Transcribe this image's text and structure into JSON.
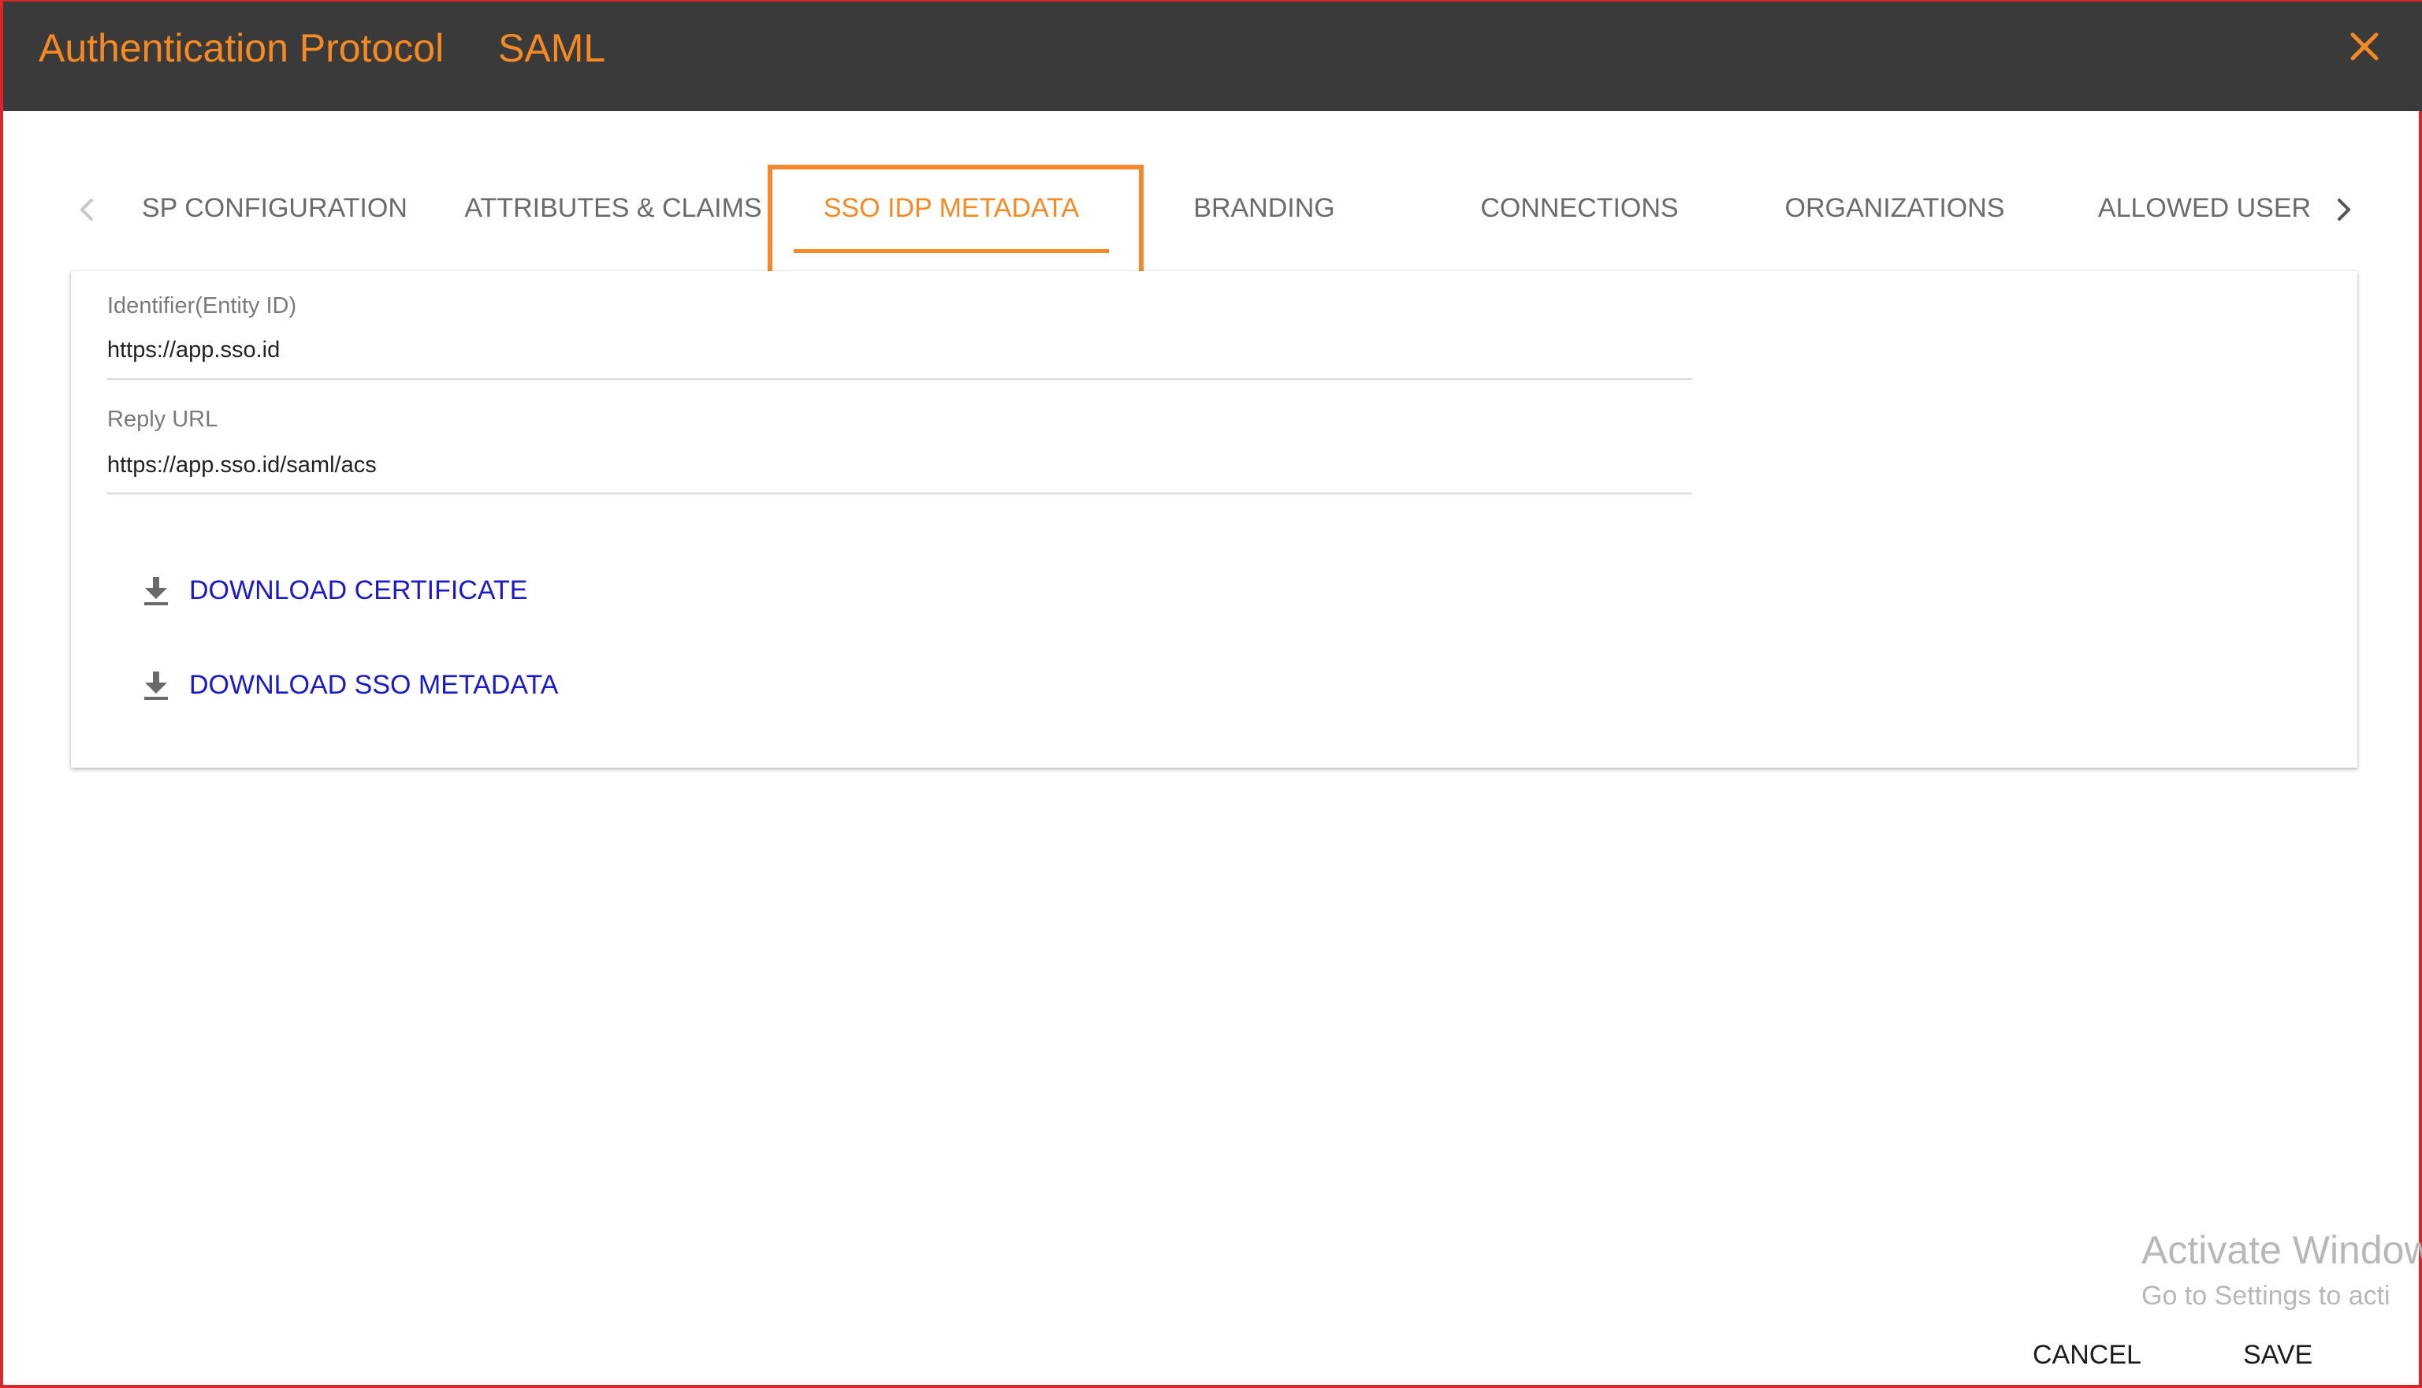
{
  "header": {
    "title": "Authentication Protocol",
    "protocol": "SAML",
    "close_icon": "close-icon",
    "background_color": "#3a3a3a",
    "accent_color": "#f58a24"
  },
  "tabs": {
    "prev_icon": "chevron-left-icon",
    "next_icon": "chevron-right-icon",
    "items": [
      {
        "label": "SP CONFIGURATION",
        "active": false
      },
      {
        "label": "ATTRIBUTES & CLAIMS",
        "active": false
      },
      {
        "label": "SSO IDP METADATA",
        "active": true
      },
      {
        "label": "BRANDING",
        "active": false
      },
      {
        "label": "CONNECTIONS",
        "active": false
      },
      {
        "label": "ORGANIZATIONS",
        "active": false
      },
      {
        "label": "ALLOWED USER",
        "active": false
      }
    ]
  },
  "form": {
    "identifier": {
      "label": "Identifier(Entity ID)",
      "value": "https://app.sso.id"
    },
    "reply_url": {
      "label": "Reply URL",
      "value": "https://app.sso.id/saml/acs"
    }
  },
  "actions": {
    "download_certificate": "DOWNLOAD CERTIFICATE",
    "download_sso_metadata": "DOWNLOAD SSO METADATA",
    "download_icon": "download-icon",
    "link_color": "#1a1acc"
  },
  "watermark": {
    "line1": "Activate Window",
    "line2": "Go to Settings to acti"
  },
  "footer": {
    "cancel_label": "CANCEL",
    "save_label": "SAVE"
  }
}
